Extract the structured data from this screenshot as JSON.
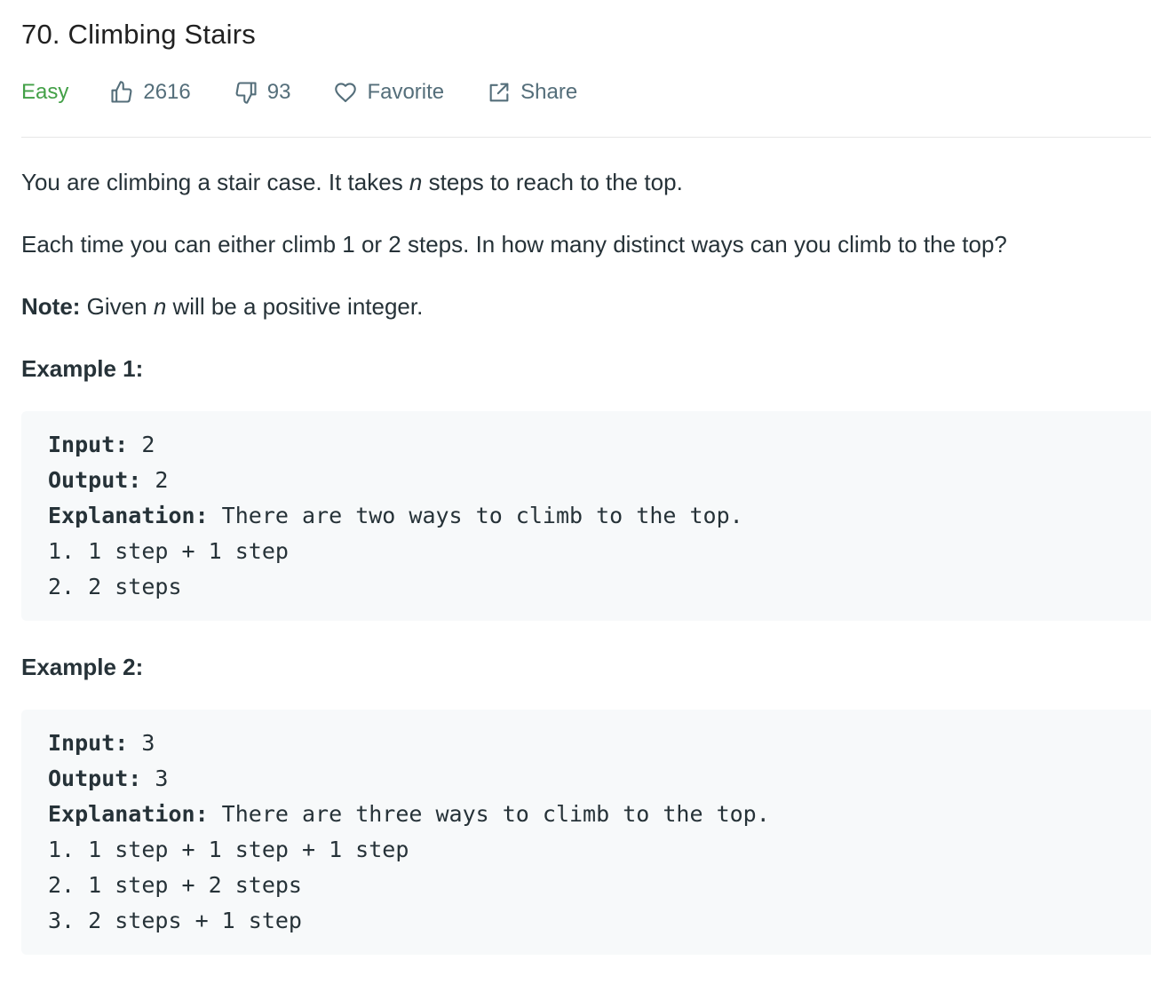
{
  "problem": {
    "title": "70. Climbing Stairs",
    "difficulty": "Easy",
    "likes": "2616",
    "dislikes": "93",
    "favorite_label": "Favorite",
    "share_label": "Share"
  },
  "description": {
    "p1_before": "You are climbing a stair case. It takes ",
    "p1_var": "n",
    "p1_after": " steps to reach to the top.",
    "p2": "Each time you can either climb 1 or 2 steps. In how many distinct ways can you climb to the top?",
    "note_label": "Note:",
    "note_before": " Given ",
    "note_var": "n",
    "note_after": " will be a positive integer."
  },
  "examples": [
    {
      "title": "Example 1:",
      "input_label": "Input:",
      "input_value": " 2",
      "output_label": "Output:",
      "output_value": " 2",
      "explanation_label": "Explanation:",
      "explanation_text": " There are two ways to climb to the top.",
      "lines": [
        "1. 1 step + 1 step",
        "2. 2 steps"
      ]
    },
    {
      "title": "Example 2:",
      "input_label": "Input:",
      "input_value": " 3",
      "output_label": "Output:",
      "output_value": " 3",
      "explanation_label": "Explanation:",
      "explanation_text": " There are three ways to climb to the top.",
      "lines": [
        "1. 1 step + 1 step + 1 step",
        "2. 1 step + 2 steps",
        "3. 2 steps + 1 step"
      ]
    }
  ],
  "icons": {
    "like": "thumbs-up-icon",
    "dislike": "thumbs-down-icon",
    "favorite": "heart-icon",
    "share": "share-icon"
  },
  "colors": {
    "difficulty_easy": "#43a047",
    "meta_text": "#546e7a",
    "code_background": "#f7f9fa"
  }
}
